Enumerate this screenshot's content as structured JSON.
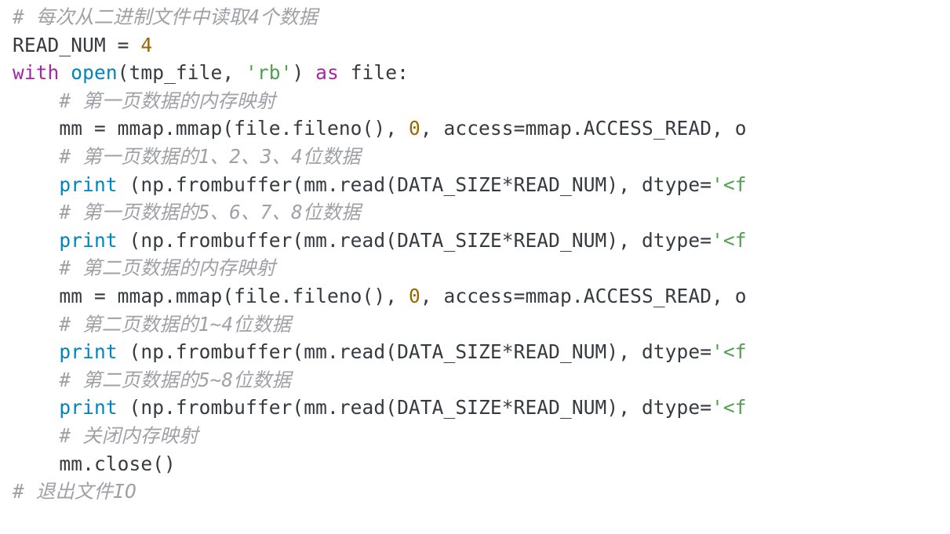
{
  "code": {
    "lines": [
      {
        "indent": "",
        "tokens": [
          {
            "cls": "tok-cm",
            "text": "# 每次从二进制文件中读取4个数据"
          }
        ]
      },
      {
        "indent": "",
        "tokens": [
          {
            "cls": "tok-id",
            "text": "READ_NUM "
          },
          {
            "cls": "tok-op",
            "text": "="
          },
          {
            "cls": "tok-id",
            "text": " "
          },
          {
            "cls": "tok-nm",
            "text": "4"
          }
        ]
      },
      {
        "indent": "",
        "tokens": [
          {
            "cls": "tok-kw",
            "text": "with"
          },
          {
            "cls": "tok-id",
            "text": " "
          },
          {
            "cls": "tok-bn",
            "text": "open"
          },
          {
            "cls": "tok-id",
            "text": "(tmp_file, "
          },
          {
            "cls": "tok-st",
            "text": "'rb'"
          },
          {
            "cls": "tok-id",
            "text": ") "
          },
          {
            "cls": "tok-kw",
            "text": "as"
          },
          {
            "cls": "tok-id",
            "text": " file:"
          }
        ]
      },
      {
        "indent": "    ",
        "tokens": [
          {
            "cls": "tok-cm",
            "text": "# 第一页数据的内存映射"
          }
        ]
      },
      {
        "indent": "    ",
        "tokens": [
          {
            "cls": "tok-id",
            "text": "mm "
          },
          {
            "cls": "tok-op",
            "text": "="
          },
          {
            "cls": "tok-id",
            "text": " mmap.mmap(file.fileno(), "
          },
          {
            "cls": "tok-nm",
            "text": "0"
          },
          {
            "cls": "tok-id",
            "text": ", access"
          },
          {
            "cls": "tok-op",
            "text": "="
          },
          {
            "cls": "tok-id",
            "text": "mmap.ACCESS_READ, o"
          }
        ]
      },
      {
        "indent": "    ",
        "tokens": [
          {
            "cls": "tok-cm",
            "text": "# 第一页数据的1、2、3、4位数据"
          }
        ]
      },
      {
        "indent": "    ",
        "tokens": [
          {
            "cls": "tok-bn",
            "text": "print"
          },
          {
            "cls": "tok-id",
            "text": " (np.frombuffer(mm.read(DATA_SIZE"
          },
          {
            "cls": "tok-op",
            "text": "*"
          },
          {
            "cls": "tok-id",
            "text": "READ_NUM), dtype"
          },
          {
            "cls": "tok-op",
            "text": "="
          },
          {
            "cls": "tok-st",
            "text": "'<f"
          }
        ]
      },
      {
        "indent": "    ",
        "tokens": [
          {
            "cls": "tok-cm",
            "text": "# 第一页数据的5、6、7、8位数据"
          }
        ]
      },
      {
        "indent": "    ",
        "tokens": [
          {
            "cls": "tok-bn",
            "text": "print"
          },
          {
            "cls": "tok-id",
            "text": " (np.frombuffer(mm.read(DATA_SIZE"
          },
          {
            "cls": "tok-op",
            "text": "*"
          },
          {
            "cls": "tok-id",
            "text": "READ_NUM), dtype"
          },
          {
            "cls": "tok-op",
            "text": "="
          },
          {
            "cls": "tok-st",
            "text": "'<f"
          }
        ]
      },
      {
        "indent": "    ",
        "tokens": [
          {
            "cls": "tok-cm",
            "text": "# 第二页数据的内存映射"
          }
        ]
      },
      {
        "indent": "    ",
        "tokens": [
          {
            "cls": "tok-id",
            "text": "mm "
          },
          {
            "cls": "tok-op",
            "text": "="
          },
          {
            "cls": "tok-id",
            "text": " mmap.mmap(file.fileno(), "
          },
          {
            "cls": "tok-nm",
            "text": "0"
          },
          {
            "cls": "tok-id",
            "text": ", access"
          },
          {
            "cls": "tok-op",
            "text": "="
          },
          {
            "cls": "tok-id",
            "text": "mmap.ACCESS_READ, o"
          }
        ]
      },
      {
        "indent": "    ",
        "tokens": [
          {
            "cls": "tok-cm",
            "text": "# 第二页数据的1~4位数据"
          }
        ]
      },
      {
        "indent": "    ",
        "tokens": [
          {
            "cls": "tok-bn",
            "text": "print"
          },
          {
            "cls": "tok-id",
            "text": " (np.frombuffer(mm.read(DATA_SIZE"
          },
          {
            "cls": "tok-op",
            "text": "*"
          },
          {
            "cls": "tok-id",
            "text": "READ_NUM), dtype"
          },
          {
            "cls": "tok-op",
            "text": "="
          },
          {
            "cls": "tok-st",
            "text": "'<f"
          }
        ]
      },
      {
        "indent": "    ",
        "tokens": [
          {
            "cls": "tok-cm",
            "text": "# 第二页数据的5~8位数据"
          }
        ]
      },
      {
        "indent": "    ",
        "tokens": [
          {
            "cls": "tok-bn",
            "text": "print"
          },
          {
            "cls": "tok-id",
            "text": " (np.frombuffer(mm.read(DATA_SIZE"
          },
          {
            "cls": "tok-op",
            "text": "*"
          },
          {
            "cls": "tok-id",
            "text": "READ_NUM), dtype"
          },
          {
            "cls": "tok-op",
            "text": "="
          },
          {
            "cls": "tok-st",
            "text": "'<f"
          }
        ]
      },
      {
        "indent": "    ",
        "tokens": [
          {
            "cls": "tok-cm",
            "text": "# 关闭内存映射"
          }
        ]
      },
      {
        "indent": "    ",
        "tokens": [
          {
            "cls": "tok-id",
            "text": "mm.close()"
          }
        ]
      },
      {
        "indent": "",
        "tokens": [
          {
            "cls": "tok-cm",
            "text": "# 退出文件IO"
          }
        ]
      }
    ]
  }
}
